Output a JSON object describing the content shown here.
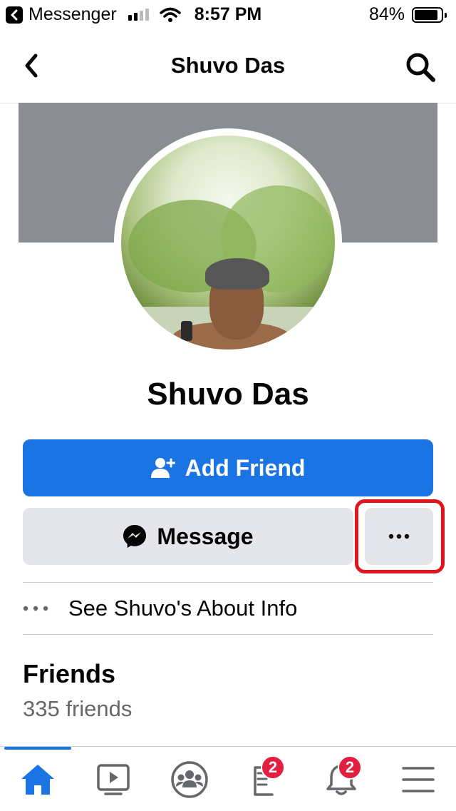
{
  "status_bar": {
    "back_app": "Messenger",
    "time": "8:57 PM",
    "battery": "84%"
  },
  "nav": {
    "title": "Shuvo Das"
  },
  "profile": {
    "name": "Shuvo Das",
    "add_friend_label": "Add Friend",
    "message_label": "Message",
    "about_label": "See Shuvo's About Info"
  },
  "friends": {
    "title": "Friends",
    "count": "335 friends"
  },
  "tabs": {
    "home": "home-icon",
    "watch": "video-icon",
    "groups": "groups-icon",
    "marketplace_badge": "2",
    "notifications_badge": "2",
    "menu": "menu-icon"
  },
  "colors": {
    "accent": "#1b74e4",
    "highlight": "#e0161c",
    "badge": "#e41e3f"
  }
}
